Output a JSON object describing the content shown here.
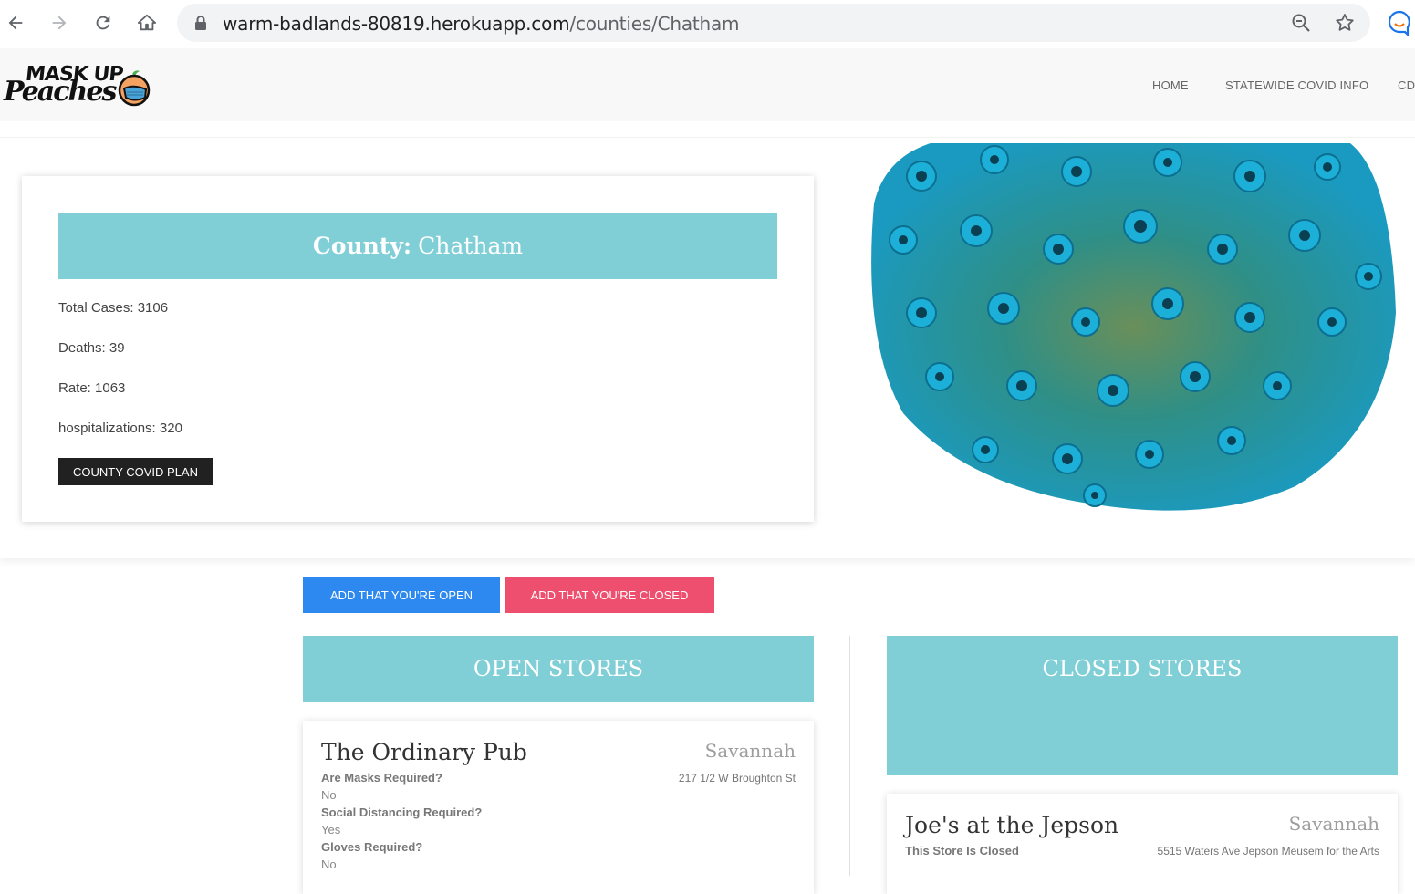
{
  "browser": {
    "url_host": "warm-badlands-80819.herokuapp.com",
    "url_path": "/counties/Chatham"
  },
  "header": {
    "logo_line1": "MASK UP",
    "logo_line2": "Peaches",
    "nav": [
      "HOME",
      "STATEWIDE COVID INFO",
      "CD"
    ]
  },
  "county": {
    "label": "County:",
    "name": "Chatham",
    "stats": [
      "Total Cases: 3106",
      "Deaths: 39",
      "Rate: 1063",
      "hospitalizations: 320"
    ],
    "plan_button": "COUNTY COVID PLAN"
  },
  "actions": {
    "open_button": "ADD THAT YOU'RE OPEN",
    "closed_button": "ADD THAT YOU'RE CLOSED"
  },
  "open_stores": {
    "title": "OPEN STORES",
    "items": [
      {
        "name": "The Ordinary Pub",
        "city": "Savannah",
        "address": "217 1/2 W Broughton St",
        "qa": [
          {
            "q": "Are Masks Required?",
            "a": "No"
          },
          {
            "q": "Social Distancing Required?",
            "a": "Yes"
          },
          {
            "q": "Gloves Required?",
            "a": "No"
          }
        ]
      }
    ]
  },
  "closed_stores": {
    "title": "CLOSED STORES",
    "items": [
      {
        "name": "Joe's at the Jepson",
        "city": "Savannah",
        "address": "5515 Waters Ave Jepson Meusem for the Arts",
        "status": "This Store Is Closed"
      }
    ]
  },
  "colors": {
    "teal": "#80ced6",
    "open_blue": "#2d89ef",
    "closed_red": "#ef4f6e",
    "dark": "#212121"
  }
}
